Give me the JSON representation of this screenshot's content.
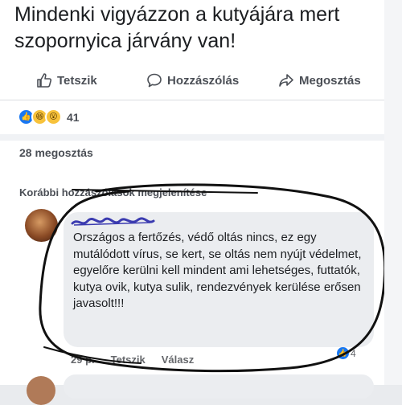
{
  "post": {
    "text": "Mindenki vigyázzon a kutyájára mert szopornyica járvány van!"
  },
  "actions": {
    "like_label": "Tetszik",
    "comment_label": "Hozzászólás",
    "share_label": "Megosztás"
  },
  "reactions": {
    "count": "41",
    "icons": [
      "like-icon",
      "haha-icon",
      "wow-icon"
    ]
  },
  "shares_text": "28 megosztás",
  "previous_comments_label": "Korábbi hozzászólások megjelenítése",
  "comment": {
    "author": "Rhocaja",
    "text": "Országos a fertőzés, védő oltás nincs, ez egy mutálódott vírus, se kert, se oltás nem nyújt védelmet, egyelőre kerülni kell mindent ami lehetséges, futtatók, kutya ovik, kutya sulik, rendezvények kerülése erősen javasolt!!!",
    "time": "29 p.",
    "like_label": "Tetszik",
    "reply_label": "Válasz",
    "reaction_count": "4"
  },
  "colors": {
    "facebook_blue": "#1877f2",
    "bubble_gray": "#ebedf0",
    "secondary_text": "#65676b",
    "ink_annotation": "#111111"
  }
}
